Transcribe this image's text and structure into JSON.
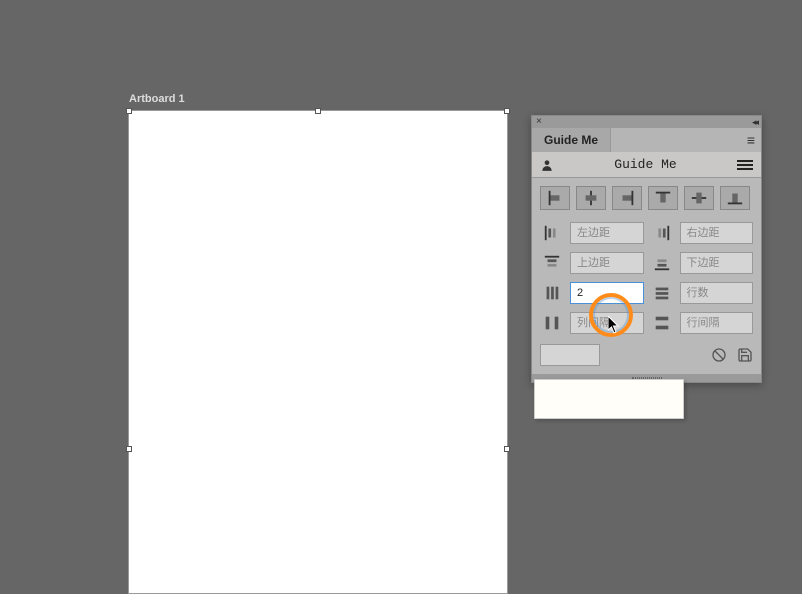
{
  "artboard": {
    "label": "Artboard 1"
  },
  "panel": {
    "tab_title": "Guide Me",
    "plugin_title": "Guide Me"
  },
  "inputs": {
    "left_margin": {
      "placeholder": "左边距",
      "value": ""
    },
    "right_margin": {
      "placeholder": "右边距",
      "value": ""
    },
    "top_margin": {
      "placeholder": "上边距",
      "value": ""
    },
    "bottom_margin": {
      "placeholder": "下边距",
      "value": ""
    },
    "columns": {
      "placeholder": "",
      "value": "2"
    },
    "rows": {
      "placeholder": "行数",
      "value": ""
    },
    "column_gap": {
      "placeholder": "列间隔",
      "value": ""
    },
    "row_gap": {
      "placeholder": "行间隔",
      "value": ""
    }
  }
}
